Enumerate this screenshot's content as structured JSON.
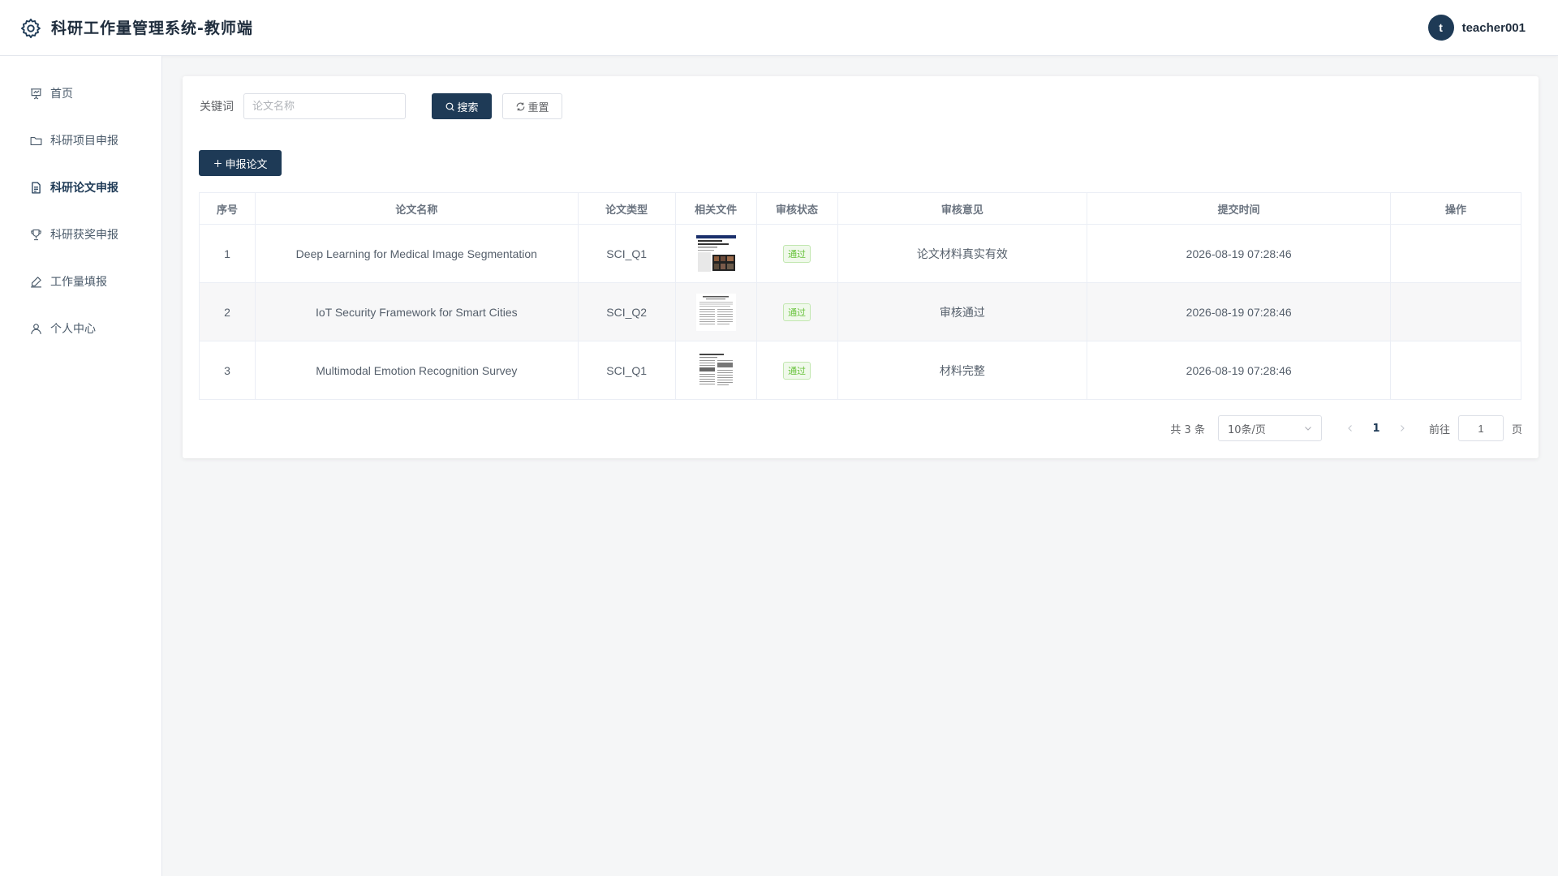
{
  "header": {
    "title": "科研工作量管理系统-教师端",
    "avatar_letter": "t",
    "username": "teacher001"
  },
  "sidebar": {
    "items": [
      {
        "label": "首页",
        "icon": "presentation-chart-icon"
      },
      {
        "label": "科研项目申报",
        "icon": "folder-icon"
      },
      {
        "label": "科研论文申报",
        "icon": "document-icon",
        "active": true
      },
      {
        "label": "科研获奖申报",
        "icon": "trophy-icon"
      },
      {
        "label": "工作量填报",
        "icon": "edit-icon"
      },
      {
        "label": "个人中心",
        "icon": "user-icon"
      }
    ]
  },
  "search": {
    "label": "关键词",
    "placeholder": "论文名称",
    "value": "",
    "search_label": "搜索",
    "reset_label": "重置"
  },
  "add_button_label": "申报论文",
  "table": {
    "columns": [
      "序号",
      "论文名称",
      "论文类型",
      "相关文件",
      "审核状态",
      "审核意见",
      "提交时间",
      "操作"
    ],
    "rows": [
      {
        "index": "1",
        "name": "Deep Learning for Medical Image Segmentation",
        "type": "SCI_Q1",
        "file": "paper-thumbnail-color",
        "status": "通过",
        "opinion": "论文材料真实有效",
        "time": "2026-08-19 07:28:46",
        "action": ""
      },
      {
        "index": "2",
        "name": "IoT Security Framework for Smart Cities",
        "type": "SCI_Q2",
        "file": "paper-thumbnail-text",
        "status": "通过",
        "opinion": "审核通过",
        "time": "2026-08-19 07:28:46",
        "action": ""
      },
      {
        "index": "3",
        "name": "Multimodal Emotion Recognition Survey",
        "type": "SCI_Q1",
        "file": "paper-thumbnail-text",
        "status": "通过",
        "opinion": "材料完整",
        "time": "2026-08-19 07:28:46",
        "action": ""
      }
    ]
  },
  "pagination": {
    "total_text": "共 3 条",
    "page_size": "10条/页",
    "current_page": "1",
    "goto_label": "前往",
    "goto_value": "1",
    "page_unit": "页"
  },
  "colors": {
    "primary": "#1e3a56",
    "success": "#67c23a",
    "background": "#f5f6f7"
  }
}
